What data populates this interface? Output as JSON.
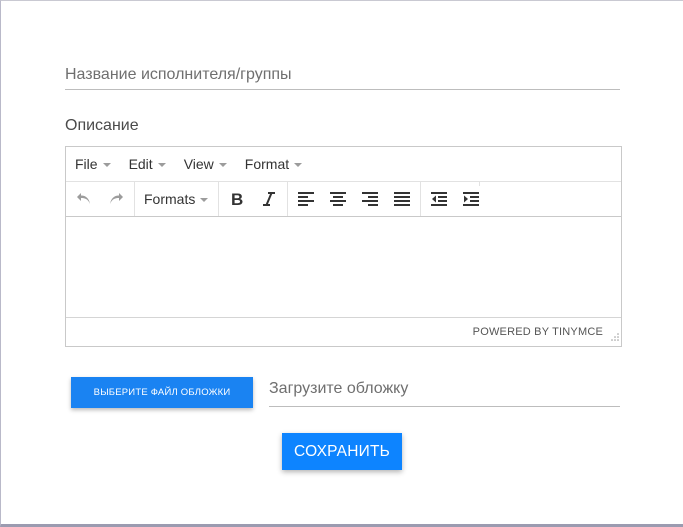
{
  "form": {
    "name_placeholder": "Название исполнителя/группы",
    "description_label": "Описание",
    "cover_button_label": "Выберите файл обложки",
    "cover_placeholder": "Загрузите обложку",
    "save_label": "Сохранить"
  },
  "editor": {
    "menu": [
      {
        "label": "File"
      },
      {
        "label": "Edit"
      },
      {
        "label": "View"
      },
      {
        "label": "Format"
      }
    ],
    "formats_label": "Formats",
    "powered_by": "Powered by TinyMCE",
    "toolbar_icons": [
      "undo-icon",
      "redo-icon",
      "bold-icon",
      "italic-icon",
      "align-left-icon",
      "align-center-icon",
      "align-right-icon",
      "align-justify-icon",
      "outdent-icon",
      "indent-icon"
    ]
  },
  "colors": {
    "primary_button": "#0d84ff",
    "icon_active": "#333333",
    "icon_disabled": "#9c9c9c"
  }
}
